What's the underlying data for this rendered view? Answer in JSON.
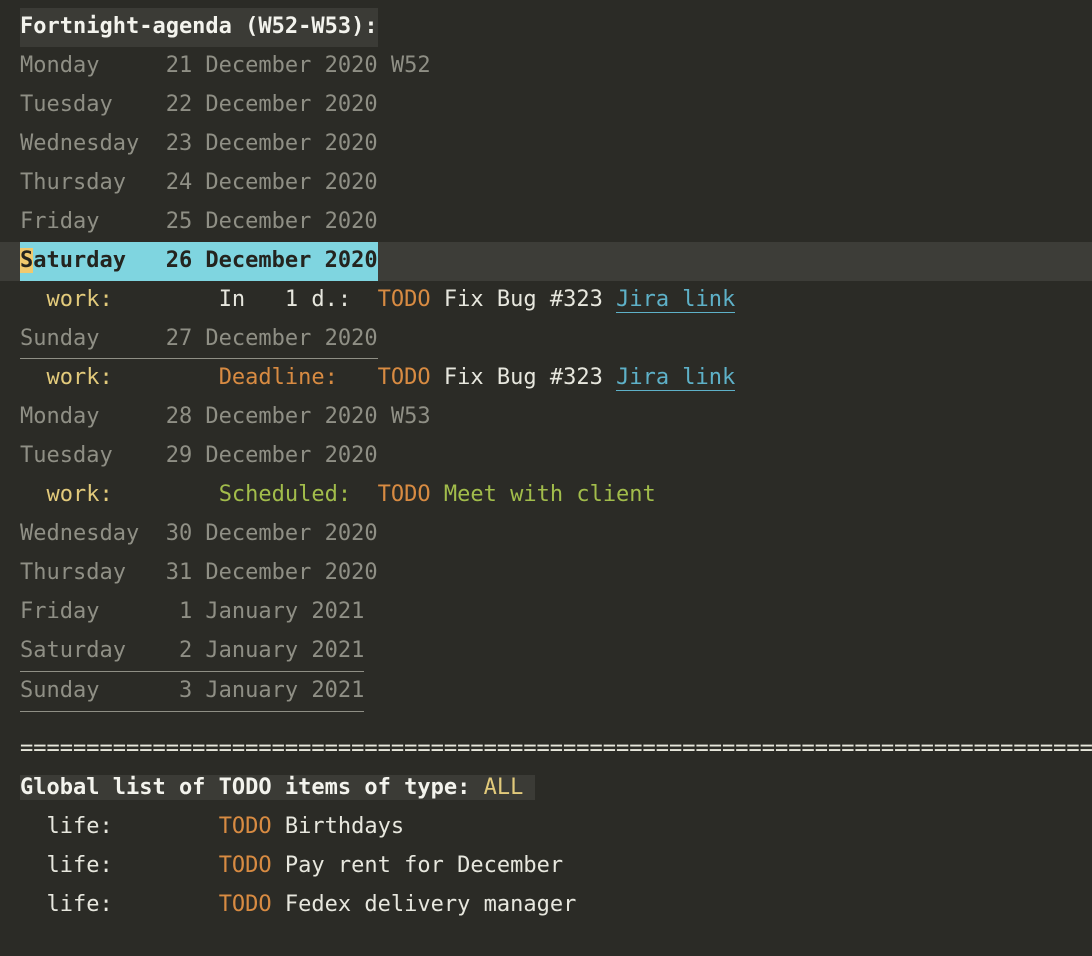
{
  "agenda": {
    "title": "Fortnight-agenda (W52-W53):",
    "days": [
      {
        "dow": "Monday",
        "date": "21 December 2020",
        "week": "W52",
        "weekend": false,
        "current": false,
        "entries": []
      },
      {
        "dow": "Tuesday",
        "date": "22 December 2020",
        "week": "",
        "weekend": false,
        "current": false,
        "entries": []
      },
      {
        "dow": "Wednesday",
        "date": "23 December 2020",
        "week": "",
        "weekend": false,
        "current": false,
        "entries": []
      },
      {
        "dow": "Thursday",
        "date": "24 December 2020",
        "week": "",
        "weekend": false,
        "current": false,
        "entries": []
      },
      {
        "dow": "Friday",
        "date": "25 December 2020",
        "week": "",
        "weekend": false,
        "current": false,
        "entries": []
      },
      {
        "dow": "Saturday",
        "date": "26 December 2020",
        "week": "",
        "weekend": true,
        "current": true,
        "entries": [
          {
            "category": "work:",
            "sched": "In   1 d.:",
            "sched_style": "upcoming",
            "todo": "TODO",
            "text": "Fix Bug #323",
            "link": "Jira link",
            "text_style": "normal"
          }
        ]
      },
      {
        "dow": "Sunday",
        "date": "27 December 2020",
        "week": "",
        "weekend": true,
        "current": false,
        "entries": [
          {
            "category": "work:",
            "sched": "Deadline:",
            "sched_style": "deadline",
            "todo": "TODO",
            "text": "Fix Bug #323",
            "link": "Jira link",
            "text_style": "normal"
          }
        ]
      },
      {
        "dow": "Monday",
        "date": "28 December 2020",
        "week": "W53",
        "weekend": false,
        "current": false,
        "entries": []
      },
      {
        "dow": "Tuesday",
        "date": "29 December 2020",
        "week": "",
        "weekend": false,
        "current": false,
        "entries": [
          {
            "category": "work:",
            "sched": "Scheduled:",
            "sched_style": "scheduled",
            "todo": "TODO",
            "text": "Meet with client",
            "link": "",
            "text_style": "green"
          }
        ]
      },
      {
        "dow": "Wednesday",
        "date": "30 December 2020",
        "week": "",
        "weekend": false,
        "current": false,
        "entries": []
      },
      {
        "dow": "Thursday",
        "date": "31 December 2020",
        "week": "",
        "weekend": false,
        "current": false,
        "entries": []
      },
      {
        "dow": "Friday",
        "date": " 1 January 2021",
        "week": "",
        "weekend": false,
        "current": false,
        "entries": []
      },
      {
        "dow": "Saturday",
        "date": " 2 January 2021",
        "week": "",
        "weekend": true,
        "current": false,
        "entries": []
      },
      {
        "dow": "Sunday",
        "date": " 3 January 2021",
        "week": "",
        "weekend": true,
        "current": false,
        "entries": []
      }
    ]
  },
  "todo_section": {
    "title": "Global list of TODO items of type:",
    "filter": "ALL",
    "items": [
      {
        "category": "life:",
        "todo": "TODO",
        "text": "Birthdays"
      },
      {
        "category": "life:",
        "todo": "TODO",
        "text": "Pay rent for December"
      },
      {
        "category": "life:",
        "todo": "TODO",
        "text": "Fedex delivery manager"
      }
    ]
  },
  "divider": "================================================================================="
}
